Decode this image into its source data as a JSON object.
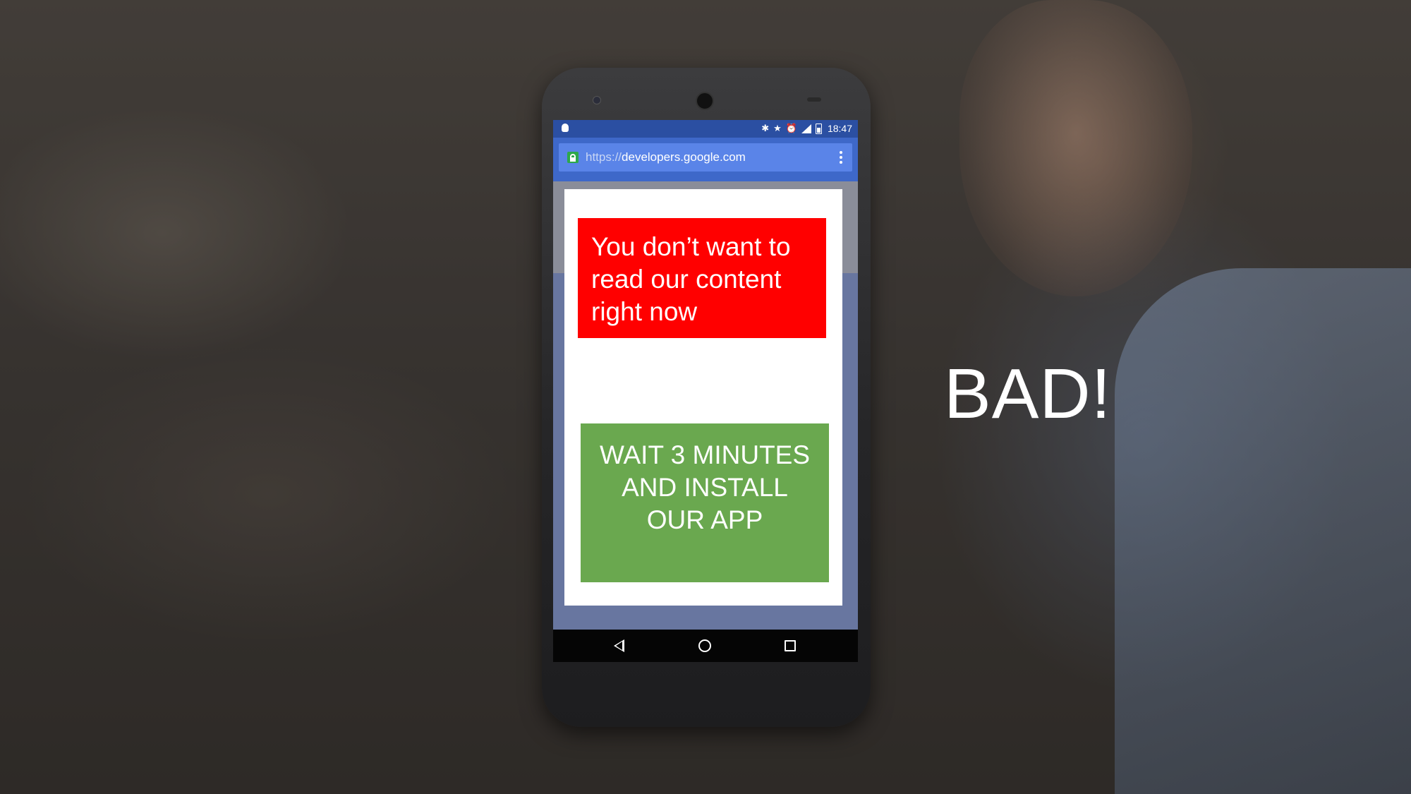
{
  "slide": {
    "verdict": "BAD!"
  },
  "status_bar": {
    "time": "18:47",
    "icons": [
      "android-icon",
      "bluetooth-icon",
      "star-icon",
      "alarm-icon",
      "signal-icon",
      "battery-icon"
    ]
  },
  "browser": {
    "url_scheme": "https://",
    "url_host": "developers.google.com"
  },
  "interstitial": {
    "message": "You don’t want to read our content right now",
    "cta_label": "WAIT 3 MINUTES AND INSTALL OUR APP"
  },
  "colors": {
    "message_bg": "#ff0000",
    "cta_bg": "#6aa84f",
    "toolbar": "#3e68c9",
    "status_bar": "#2b4fa2"
  },
  "nav_bar": {
    "buttons": [
      "back-icon",
      "home-icon",
      "recents-icon"
    ]
  }
}
